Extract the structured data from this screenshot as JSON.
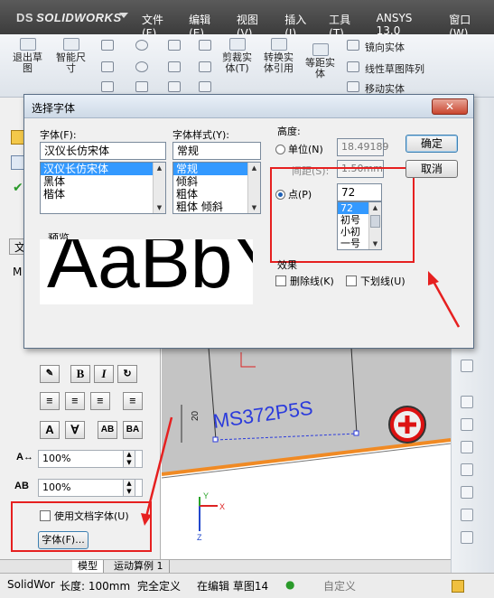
{
  "app": {
    "logo_prefix": "DS",
    "logo": "SOLIDWORKS"
  },
  "menu": [
    "文件(F)",
    "编辑(E)",
    "视图(V)",
    "插入(I)",
    "工具(T)",
    "ANSYS 13.0",
    "窗口(W)"
  ],
  "toolbar": {
    "exit_sketch": [
      "退出草",
      "图"
    ],
    "smart_dimension": [
      "智能尺",
      "寸"
    ],
    "trim": [
      "剪裁实",
      "体(T)"
    ],
    "convert": [
      "转换实",
      "体引用"
    ],
    "offset": [
      "等距实",
      "体"
    ],
    "mirror": "镜向实体",
    "linear_pattern": "线性草图阵列",
    "move": "移动实体"
  },
  "dialog": {
    "title": "选择字体",
    "font_label": "字体(F):",
    "font_value": "汉仪长仿宋体",
    "font_list": [
      "汉仪长仿宋体",
      "黑体",
      "楷体"
    ],
    "style_label": "字体样式(Y):",
    "style_value": "常规",
    "style_list": [
      "常规",
      "倾斜",
      "粗体",
      "粗体 倾斜"
    ],
    "height_label": "高度:",
    "unit_label": "单位(N)",
    "unit_value": "18.49189",
    "spacing_label": "间距(S):",
    "spacing_value": "1.50mm",
    "point_label": "点(P)",
    "point_value": "72",
    "point_list": [
      "72",
      "初号",
      "小初",
      "一号"
    ],
    "ok_label": "确定",
    "cancel_label": "取消",
    "preview_label": "预览",
    "preview_text": "AaBbYy",
    "effects_label": "效果",
    "strikeout_label": "删除线(K)",
    "underline_label": "下划线(U)"
  },
  "panel": {
    "width_pct": "100%",
    "spacing_pct": "100%",
    "use_doc_font": "使用文档字体(U)",
    "font_button": "字体(F)...",
    "tab_fragment_1": "文",
    "tab_fragment_2": "M"
  },
  "canvas": {
    "dim_text": "20",
    "part_text": "MS372P5S",
    "axis_x": "X",
    "axis_y": "Y",
    "axis_z": "Z"
  },
  "tabs": {
    "model": "模型",
    "motion": "运动算例 1"
  },
  "status": {
    "app": "SolidWor",
    "length": "长度: 100mm",
    "defined": "完全定义",
    "editing": "在编辑 草图14",
    "custom": "自定义"
  },
  "colors": {
    "annotation_red": "#e62020",
    "sketch_blue": "#2b3bdc",
    "edge_orange": "#f08a24"
  }
}
